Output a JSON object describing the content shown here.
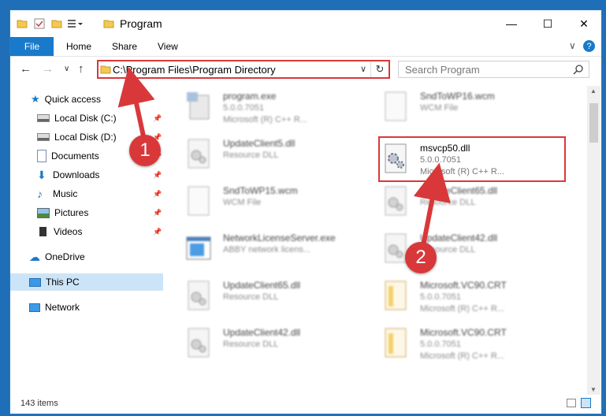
{
  "window": {
    "title": "Program",
    "controls": {
      "minimize": "—",
      "maximize": "☐",
      "close": "✕"
    }
  },
  "ribbon": {
    "file": "File",
    "tabs": [
      "Home",
      "Share",
      "View"
    ],
    "help": "?"
  },
  "navigation": {
    "address": "C:\\Program Files\\Program Directory",
    "search_placeholder": "Search Program"
  },
  "sidebar": {
    "items": [
      {
        "label": "Quick access",
        "icon": "star-icon",
        "pinned": false
      },
      {
        "label": "Local Disk (C:)",
        "icon": "drive-icon",
        "pinned": true
      },
      {
        "label": "Local Disk (D:)",
        "icon": "drive-icon",
        "pinned": true
      },
      {
        "label": "Documents",
        "icon": "documents-icon",
        "pinned": true
      },
      {
        "label": "Downloads",
        "icon": "download-icon",
        "pinned": true
      },
      {
        "label": "Music",
        "icon": "music-icon",
        "pinned": true
      },
      {
        "label": "Pictures",
        "icon": "pictures-icon",
        "pinned": true
      },
      {
        "label": "Videos",
        "icon": "videos-icon",
        "pinned": true
      },
      {
        "label": "OneDrive",
        "icon": "cloud-icon",
        "pinned": false
      },
      {
        "label": "This PC",
        "icon": "pc-icon",
        "pinned": false,
        "selected": true
      },
      {
        "label": "Network",
        "icon": "network-icon",
        "pinned": false
      }
    ]
  },
  "files": {
    "left": [
      {
        "name": "program.exe",
        "line2": "5.0.0.7051",
        "line3": "Microsoft (R) C++ R...",
        "icon": "exe-icon"
      },
      {
        "name": "UpdateClient5.dll",
        "line2": "Resource DLL",
        "line3": "",
        "icon": "dll-icon"
      },
      {
        "name": "SndToWP15.wcm",
        "line2": "WCM File",
        "line3": "",
        "icon": "file-icon"
      },
      {
        "name": "NetworkLicenseServer.exe",
        "line2": "ABBY network licens...",
        "line3": "",
        "icon": "app-icon"
      },
      {
        "name": "UpdateClient65.dll",
        "line2": "Resource DLL",
        "line3": "",
        "icon": "dll-icon"
      },
      {
        "name": "UpdateClient42.dll",
        "line2": "Resource DLL",
        "line3": "",
        "icon": "dll-icon"
      }
    ],
    "right": [
      {
        "name": "SndToWP16.wcm",
        "line2": "WCM File",
        "line3": "",
        "icon": "file-icon"
      },
      {
        "name": "msvcp50.dll",
        "line2": "5.0.0.7051",
        "line3": "Microsoft (R) C++ R...",
        "icon": "dll-icon",
        "highlighted": true
      },
      {
        "name": "UpdateClient65.dll",
        "line2": "Resource DLL",
        "line3": "",
        "icon": "dll-icon"
      },
      {
        "name": "UpdateClient42.dll",
        "line2": "Resource DLL",
        "line3": "",
        "icon": "dll-icon"
      },
      {
        "name": "Microsoft.VC90.CRT",
        "line2": "5.0.0.7051",
        "line3": "Microsoft (R) C++ R...",
        "icon": "folder-file-icon"
      },
      {
        "name": "Microsoft.VC90.CRT",
        "line2": "5.0.0.7051",
        "line3": "Microsoft (R) C++ R...",
        "icon": "folder-file-icon"
      }
    ]
  },
  "status": {
    "item_count": "143 items"
  },
  "annotations": {
    "step1": "1",
    "step2": "2"
  },
  "colors": {
    "accent": "#1979ca",
    "highlight": "#d9383a",
    "selection": "#cce4f7"
  }
}
